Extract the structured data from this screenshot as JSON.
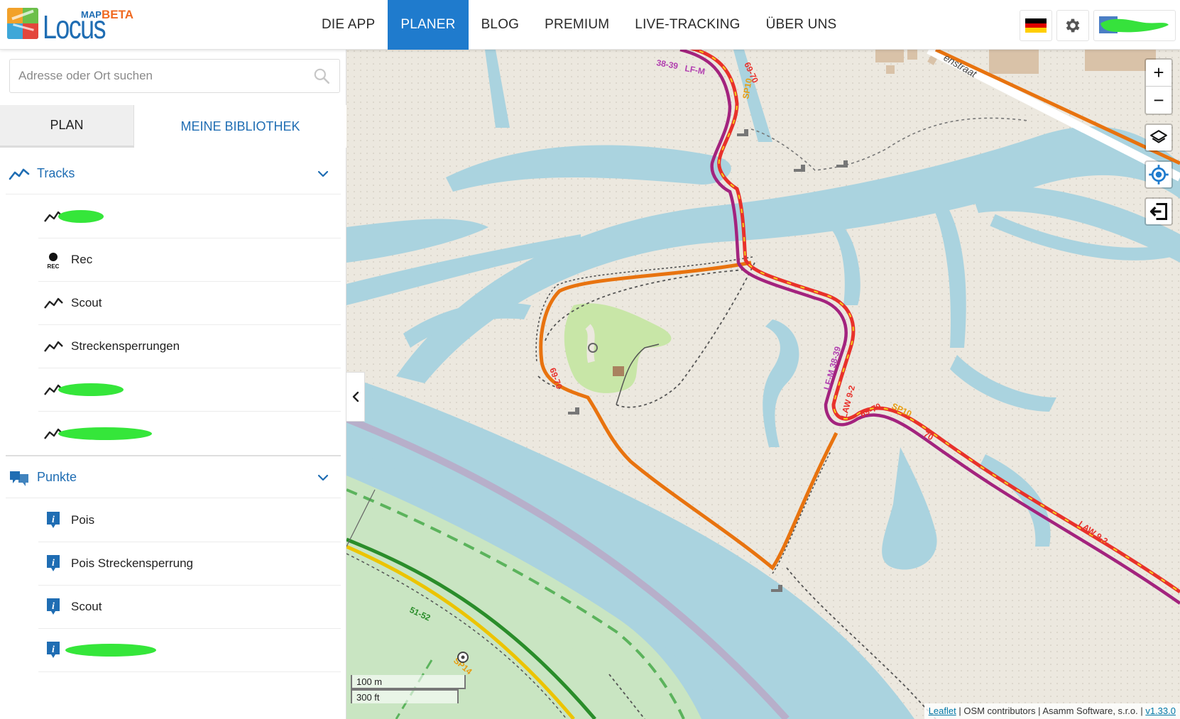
{
  "app": {
    "logo_word": "Locus",
    "logo_map": "MAP",
    "logo_beta": "BETA"
  },
  "nav": {
    "items": [
      {
        "label": "DIE APP"
      },
      {
        "label": "PLANER",
        "active": true
      },
      {
        "label": "BLOG"
      },
      {
        "label": "PREMIUM"
      },
      {
        "label": "LIVE-TRACKING"
      },
      {
        "label": "ÜBER UNS"
      }
    ]
  },
  "header_right": {
    "language_icon": "flag-germany-icon",
    "settings_icon": "gear-icon",
    "avatar": "user-avatar"
  },
  "search": {
    "placeholder": "Adresse oder Ort suchen",
    "icon": "search-icon"
  },
  "tabs": {
    "plan": "PLAN",
    "library": "MEINE BIBLIOTHEK"
  },
  "tracks": {
    "label": "Tracks",
    "icon": "track-line-icon",
    "items": [
      {
        "label": "",
        "icon": "track-line-icon"
      },
      {
        "label": "Rec",
        "icon": "rec-dot-icon"
      },
      {
        "label": "Scout",
        "icon": "track-line-icon"
      },
      {
        "label": "Streckensperrungen",
        "icon": "track-line-icon"
      },
      {
        "label": "",
        "icon": "track-line-icon"
      },
      {
        "label": "",
        "icon": "track-line-icon"
      }
    ]
  },
  "points": {
    "label": "Punkte",
    "icon": "points-folder-icon",
    "items": [
      {
        "label": "Pois",
        "icon": "info-pin-icon"
      },
      {
        "label": "Pois Streckensperrung",
        "icon": "info-pin-icon"
      },
      {
        "label": "Scout",
        "icon": "info-pin-icon"
      },
      {
        "label": "",
        "icon": "info-pin-icon"
      }
    ]
  },
  "map": {
    "zoom_in": "+",
    "zoom_out": "−",
    "scale_metric": "100 m",
    "scale_imperial": "300 ft",
    "street_label": "enstraat",
    "route_labels": {
      "a": "38-39",
      "b": "LF-M",
      "c": "69-70",
      "d": "SP10",
      "e": "LF-M  38-39",
      "f": "LAW 9-2",
      "g": "69-70",
      "h": "SP10",
      "i": "LAW 9-2",
      "j": "51-52",
      "k": "SP14",
      "l": "69-70",
      "m": "70"
    },
    "attribution": {
      "leaflet": "Leaflet",
      "sep1": " | OSM contributors | Asamm Software, s.r.o. | ",
      "version": "v1.33.0"
    }
  },
  "colors": {
    "accent": "#1f7bcd",
    "link": "#1f6db3",
    "water": "#aad3df",
    "route_red": "#e8312b",
    "route_purple": "#a3237e",
    "route_orange": "#e8730f"
  }
}
